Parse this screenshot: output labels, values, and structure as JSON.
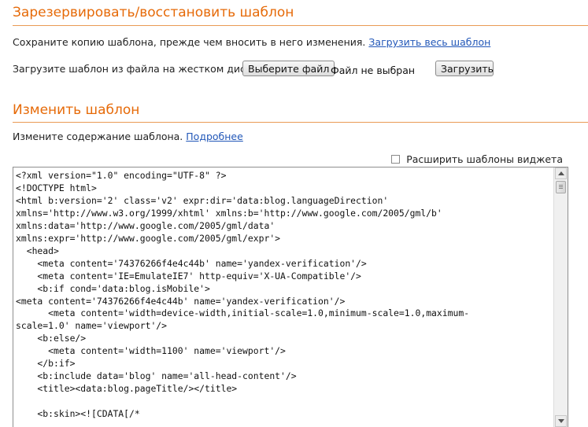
{
  "backup": {
    "title": "Зарезервировать/восстановить шаблон",
    "description": "Сохраните копию шаблона, прежде чем вносить в него изменения.",
    "download_link": "Загрузить весь шаблон",
    "upload_prompt": "Загрузите шаблон из файла на жестком диске:",
    "choose_file_button": "Выберите файл",
    "no_file_text": "Файл не выбран",
    "upload_button": "Загрузить"
  },
  "edit": {
    "title": "Изменить шаблон",
    "description": "Измените содержание шаблона.",
    "more_link": "Подробнее",
    "expand_widgets_label": "Расширить шаблоны виджета",
    "expand_widgets_checked": false,
    "code": "<?xml version=\"1.0\" encoding=\"UTF-8\" ?>\n<!DOCTYPE html>\n<html b:version='2' class='v2' expr:dir='data:blog.languageDirection'\nxmlns='http://www.w3.org/1999/xhtml' xmlns:b='http://www.google.com/2005/gml/b'\nxmlns:data='http://www.google.com/2005/gml/data'\nxmlns:expr='http://www.google.com/2005/gml/expr'>\n  <head>\n    <meta content='74376266f4e4c44b' name='yandex-verification'/>\n    <meta content='IE=EmulateIE7' http-equiv='X-UA-Compatible'/>\n    <b:if cond='data:blog.isMobile'>\n<meta content='74376266f4e4c44b' name='yandex-verification'/>\n      <meta content='width=device-width,initial-scale=1.0,minimum-scale=1.0,maximum-\nscale=1.0' name='viewport'/>\n    <b:else/>\n      <meta content='width=1100' name='viewport'/>\n    </b:if>\n    <b:include data='blog' name='all-head-content'/>\n    <title><data:blog.pageTitle/></title>\n\n    <b:skin><![CDATA[/*"
  },
  "colors": {
    "section_title": "#e66a08",
    "link": "#2257b8",
    "divider": "#e99a55"
  },
  "icons": {
    "scroll_up": "triangle-up-icon",
    "scroll_down": "triangle-down-icon"
  }
}
